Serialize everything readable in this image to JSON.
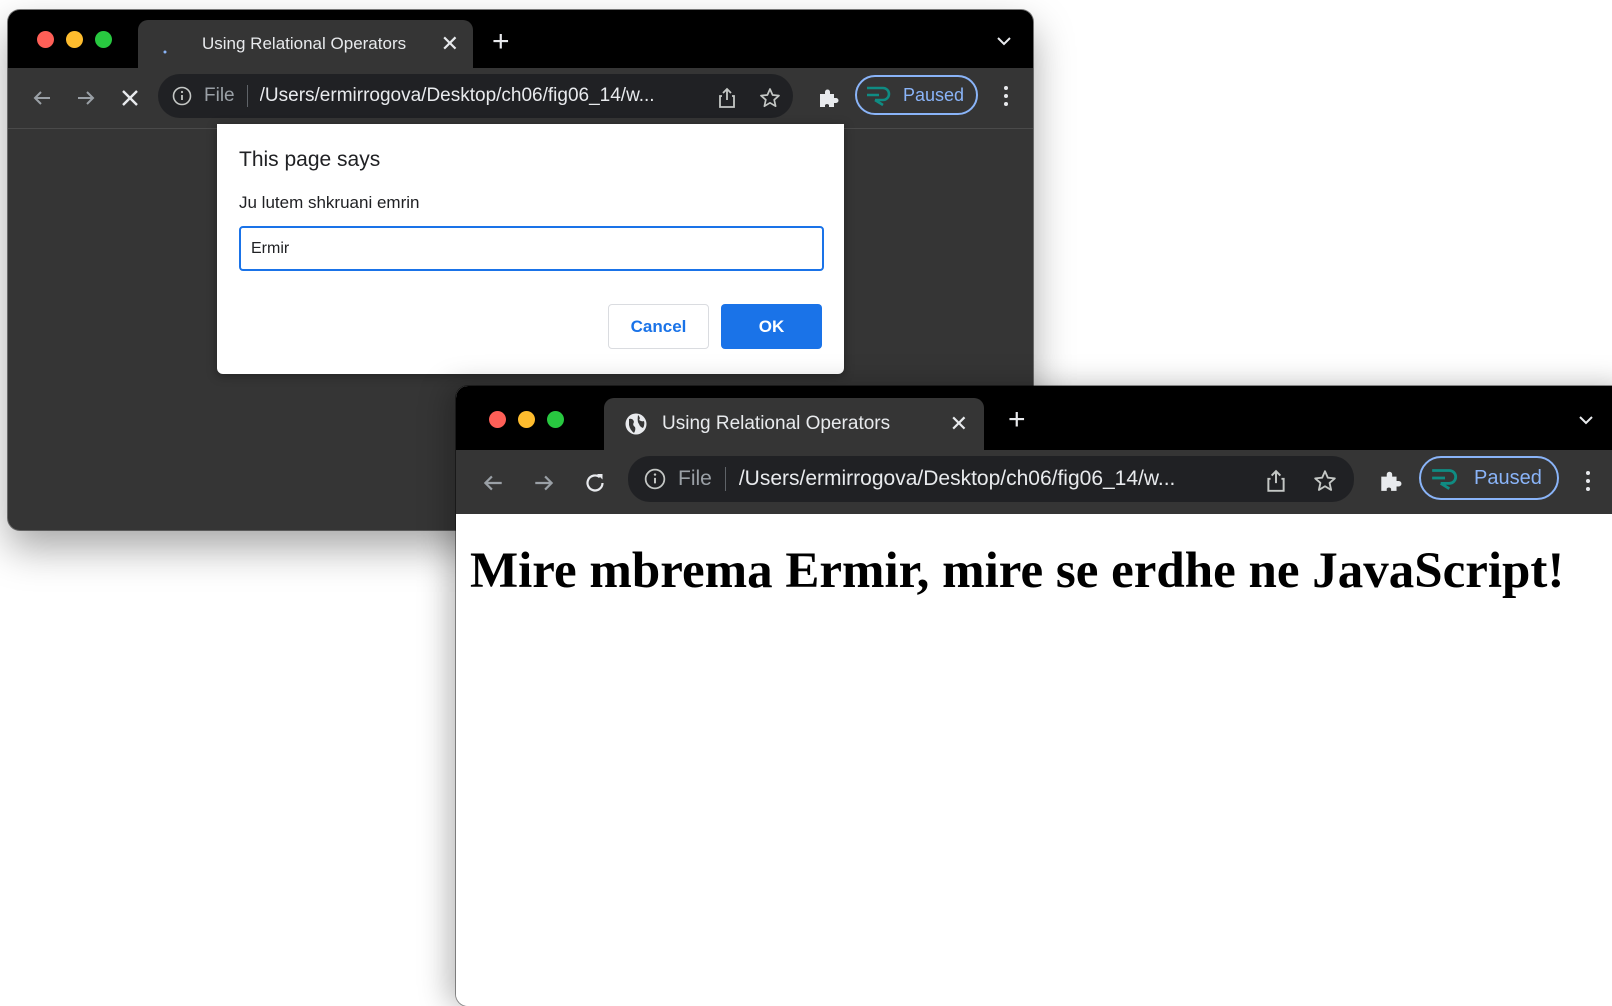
{
  "back_window": {
    "tab": {
      "title": "Using Relational Operators",
      "favicon": "loading-spinner-icon"
    },
    "omnibox": {
      "scheme": "File",
      "url": "/Users/ermirrogova/Desktop/ch06/fig06_14/w..."
    },
    "profile": {
      "label": "Paused"
    },
    "dialog": {
      "title": "This page says",
      "message": "Ju lutem shkruani emrin",
      "input_value": "Ermir",
      "cancel_label": "Cancel",
      "ok_label": "OK"
    }
  },
  "front_window": {
    "tab": {
      "title": "Using Relational Operators",
      "favicon": "globe-icon"
    },
    "omnibox": {
      "scheme": "File",
      "url": "/Users/ermirrogova/Desktop/ch06/fig06_14/w..."
    },
    "profile": {
      "label": "Paused"
    },
    "page": {
      "heading": "Mire mbrema Ermir, mire se erdhe ne JavaScript!"
    }
  },
  "colors": {
    "accent": "#1a73e8",
    "profile_paused": "#8ab4f8",
    "profile_logo": "#0f8c83",
    "tab_strip": "#000000",
    "toolbar": "#353535"
  }
}
